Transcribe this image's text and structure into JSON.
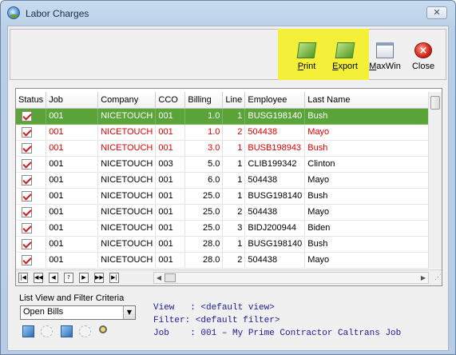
{
  "window": {
    "title": "Labor Charges",
    "close_glyph": "✕"
  },
  "toolbar": {
    "buttons": [
      {
        "label_u": "P",
        "label_rest": "rint",
        "icon": "print-icon"
      },
      {
        "label_u": "E",
        "label_rest": "xport",
        "icon": "export-icon"
      },
      {
        "label_u": "M",
        "label_rest": "axWin",
        "icon": "maximize-window-icon"
      },
      {
        "label_u": "",
        "label_rest": "Close",
        "icon": "close-icon"
      }
    ],
    "highlight_color": "#f4f03a"
  },
  "grid": {
    "columns": [
      "Status",
      "Job",
      "Company",
      "CCO",
      "Billing",
      "Line",
      "Employee",
      "Last Name"
    ],
    "rows": [
      {
        "job": "001",
        "company": "NICETOUCH",
        "cco": "001",
        "billing": "1.0",
        "line": "1",
        "employee": "BUSG198140",
        "last_name": "Bush",
        "style": "selected"
      },
      {
        "job": "001",
        "company": "NICETOUCH",
        "cco": "001",
        "billing": "1.0",
        "line": "2",
        "employee": "504438",
        "last_name": "Mayo",
        "style": "red"
      },
      {
        "job": "001",
        "company": "NICETOUCH",
        "cco": "001",
        "billing": "3.0",
        "line": "1",
        "employee": "BUSB198943",
        "last_name": "Bush",
        "style": "red"
      },
      {
        "job": "001",
        "company": "NICETOUCH",
        "cco": "003",
        "billing": "5.0",
        "line": "1",
        "employee": "CLIB199342",
        "last_name": "Clinton",
        "style": "normal"
      },
      {
        "job": "001",
        "company": "NICETOUCH",
        "cco": "001",
        "billing": "6.0",
        "line": "1",
        "employee": "504438",
        "last_name": "Mayo",
        "style": "normal"
      },
      {
        "job": "001",
        "company": "NICETOUCH",
        "cco": "001",
        "billing": "25.0",
        "line": "1",
        "employee": "BUSG198140",
        "last_name": "Bush",
        "style": "normal"
      },
      {
        "job": "001",
        "company": "NICETOUCH",
        "cco": "001",
        "billing": "25.0",
        "line": "2",
        "employee": "504438",
        "last_name": "Mayo",
        "style": "normal"
      },
      {
        "job": "001",
        "company": "NICETOUCH",
        "cco": "001",
        "billing": "25.0",
        "line": "3",
        "employee": "BIDJ200944",
        "last_name": "Biden",
        "style": "normal"
      },
      {
        "job": "001",
        "company": "NICETOUCH",
        "cco": "001",
        "billing": "28.0",
        "line": "1",
        "employee": "BUSG198140",
        "last_name": "Bush",
        "style": "normal"
      },
      {
        "job": "001",
        "company": "NICETOUCH",
        "cco": "001",
        "billing": "28.0",
        "line": "2",
        "employee": "504438",
        "last_name": "Mayo",
        "style": "normal"
      }
    ],
    "nav_buttons": [
      "|◀",
      "◀◀",
      "◀",
      "?",
      "▶",
      "▶▶",
      "▶|"
    ],
    "selected_color": "#5aa43a",
    "red_color": "#e10000"
  },
  "list_view": {
    "label": "List View and Filter Criteria",
    "selected": "Open Bills"
  },
  "info": {
    "view": "View   : <default view>",
    "filter": "Filter: <default filter>",
    "job": "Job    : 001 – My Prime Contractor Caltrans Job"
  }
}
